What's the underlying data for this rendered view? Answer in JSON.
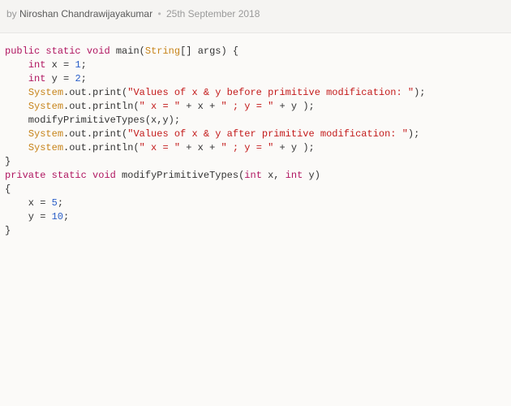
{
  "meta": {
    "by_prefix": "by ",
    "author": "Niroshan Chandrawijayakumar",
    "bullet": "•",
    "date": "25th September 2018"
  },
  "code": {
    "line1_kw1": "public",
    "line1_kw2": "static",
    "line1_kw3": "void",
    "line1_main": " main(",
    "line1_type": "String",
    "line1_rest": "[] args) {",
    "indent": "    ",
    "line2_kw": "int",
    "line2_rest_a": " x = ",
    "line2_num": "1",
    "line2_rest_b": ";",
    "line3_kw": "int",
    "line3_rest_a": " y = ",
    "line3_num": "2",
    "line3_rest_b": ";",
    "line4_sys": "System",
    "line4_call": ".out.print(",
    "line4_str": "\"Values of x & y before primitive modification: \"",
    "line4_end": ");",
    "line5_sys": "System",
    "line5_call": ".out.println(",
    "line5_str1": "\" x = \"",
    "line5_mid1": " + x + ",
    "line5_str2": "\" ; y = \"",
    "line5_mid2": " + y );",
    "line6": "    modifyPrimitiveTypes(x,y);",
    "line7_sys": "System",
    "line7_call": ".out.print(",
    "line7_str": "\"Values of x & y after primitive modification: \"",
    "line7_end": ");",
    "line8_sys": "System",
    "line8_call": ".out.println(",
    "line8_str1": "\" x = \"",
    "line8_mid1": " + x + ",
    "line8_str2": "\" ; y = \"",
    "line8_mid2": " + y );",
    "line9": "}",
    "line10_kw1": "private",
    "line10_kw2": "static",
    "line10_kw3": "void",
    "line10_name": " modifyPrimitiveTypes(",
    "line10_kwp1": "int",
    "line10_p1": " x, ",
    "line10_kwp2": "int",
    "line10_p2": " y)",
    "line11": "{",
    "line12_a": "    x = ",
    "line12_num": "5",
    "line12_b": ";",
    "line13_a": "    y = ",
    "line13_num": "10",
    "line13_b": ";",
    "line14": "}"
  }
}
